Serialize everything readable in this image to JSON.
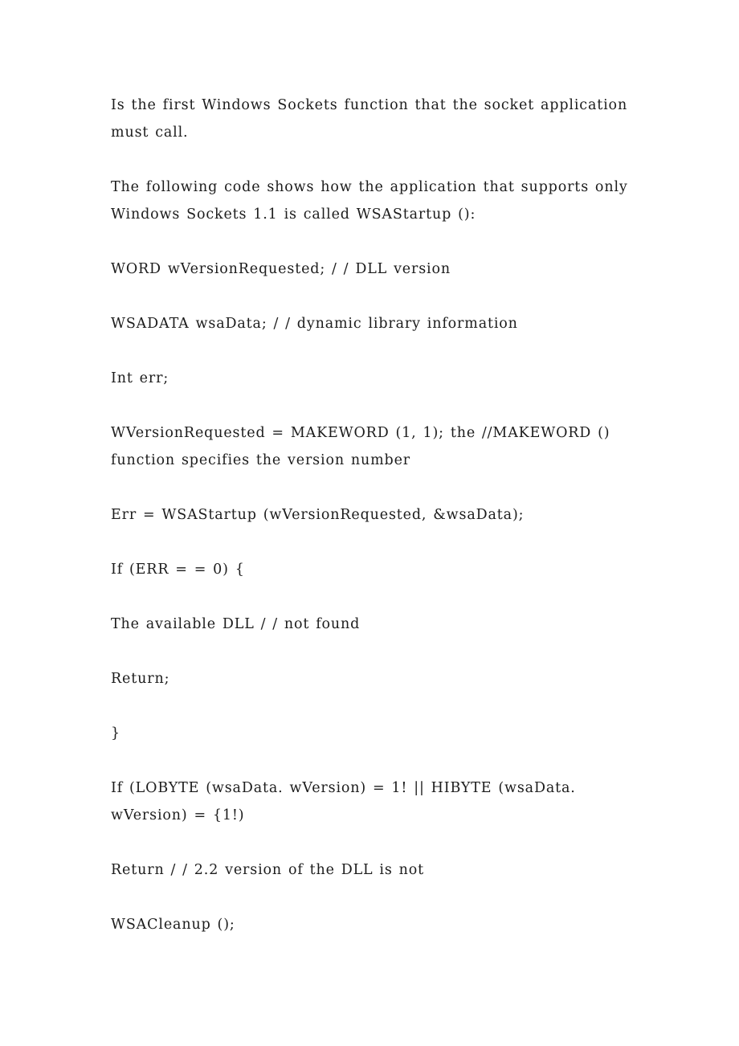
{
  "document": {
    "background_color": "#ffffff",
    "text_color": "#1c1c1c",
    "paragraphs": [
      {
        "id": "p1",
        "text": "Is the first Windows Sockets function that the socket application must call."
      },
      {
        "id": "p2",
        "text": "The following code shows how the application that supports only Windows Sockets 1.1 is called WSAStartup ():"
      },
      {
        "id": "p3",
        "text": "WORD wVersionRequested; / / DLL version"
      },
      {
        "id": "p4",
        "text": "WSADATA wsaData; / / dynamic library information"
      },
      {
        "id": "p5",
        "text": "Int err;"
      },
      {
        "id": "p6",
        "text": "WVersionRequested = MAKEWORD (1, 1); the //MAKEWORD () function specifies the version number"
      },
      {
        "id": "p7",
        "text": "Err = WSAStartup (wVersionRequested, &wsaData);"
      },
      {
        "id": "p8",
        "text": "If (ERR = = 0) {"
      },
      {
        "id": "p9",
        "text": "The available DLL / / not found"
      },
      {
        "id": "p10",
        "text": "Return;"
      },
      {
        "id": "p11",
        "text": "}"
      },
      {
        "id": "p12",
        "text": "If (LOBYTE (wsaData. wVersion) = 1! || HIBYTE (wsaData. wVersion) = {1!)"
      },
      {
        "id": "p13",
        "text": "Return / / 2.2 version of the DLL is not"
      },
      {
        "id": "p14",
        "text": "WSACleanup ();"
      }
    ]
  }
}
